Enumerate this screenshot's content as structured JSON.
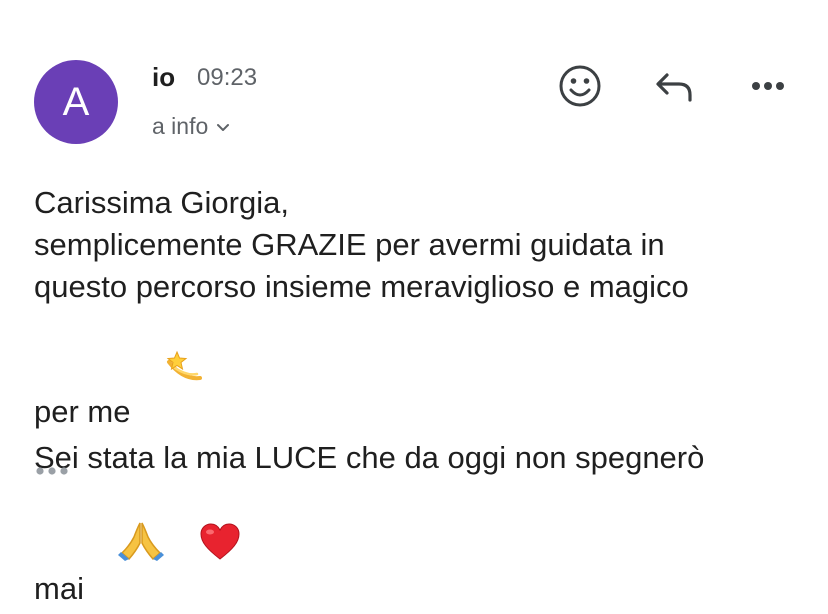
{
  "header": {
    "avatar_initial": "A",
    "avatar_color": "#6a3fb6",
    "sender": "io",
    "time": "09:23",
    "recipient": "a info"
  },
  "actions": {
    "emoji_icon": "add-reaction-icon",
    "reply_icon": "reply-icon",
    "more_icon": "more-horizontal-icon"
  },
  "message": {
    "line1": "Carissima Giorgia,",
    "line2": "semplicemente GRAZIE per avermi guidata in",
    "line3": "questo percorso insieme meraviglioso e magico",
    "line4": "per me",
    "line4_emoji": "💫",
    "line5": "Sei stata la mia LUCE che da oggi non spegnerò",
    "line6": "mai",
    "line6_emojis": [
      "🙏",
      "❤️"
    ]
  },
  "trimmed_content_icon": "ellipsis-icon"
}
